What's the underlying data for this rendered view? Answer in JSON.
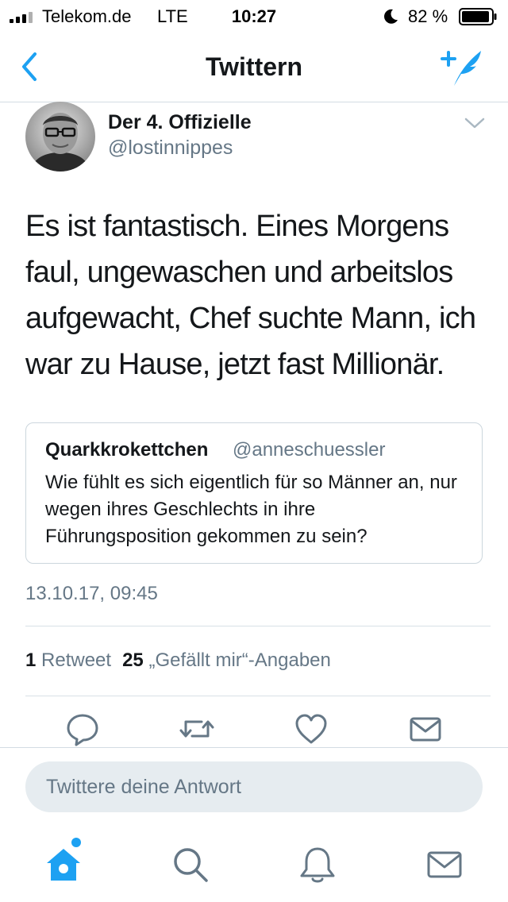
{
  "status_bar": {
    "carrier": "Telekom.de",
    "network": "LTE",
    "time": "10:27",
    "battery_percent": "82 %",
    "icons": [
      "signal-icon",
      "moon-icon",
      "battery-icon"
    ]
  },
  "nav": {
    "title": "Twittern",
    "back_icon": "chevron-left-icon",
    "compose_icon": "compose-tweet-icon"
  },
  "tweet": {
    "author_name": "Der 4. Offizielle",
    "author_handle": "@lostinnippes",
    "text": "Es ist fantastisch. Eines Morgens faul, ungewaschen und arbeitslos aufgewacht, Chef suchte Mann, ich war zu Hause, jetzt fast Millionär.",
    "timestamp": "13.10.17, 09:45",
    "retweet_count": "1",
    "retweet_label": "Retweet",
    "like_count": "25",
    "like_label": "„Gefällt mir“-Angaben"
  },
  "quoted_tweet": {
    "author_name": "Quarkkrokettchen",
    "author_handle": "@anneschuessler",
    "text": "Wie fühlt es sich eigentlich für so Männer an, nur wegen ihres Geschlechts in ihre Führungsposition gekommen zu sein?"
  },
  "actions": [
    "reply-icon",
    "retweet-icon",
    "like-icon",
    "direct-message-icon"
  ],
  "reply": {
    "placeholder": "Twittere deine Antwort"
  },
  "tabs": [
    "home-icon",
    "search-icon",
    "notifications-icon",
    "messages-icon"
  ],
  "colors": {
    "accent": "#1da1f2",
    "secondary_text": "#657786",
    "primary_text": "#14171a",
    "border": "#ccd6dd"
  }
}
